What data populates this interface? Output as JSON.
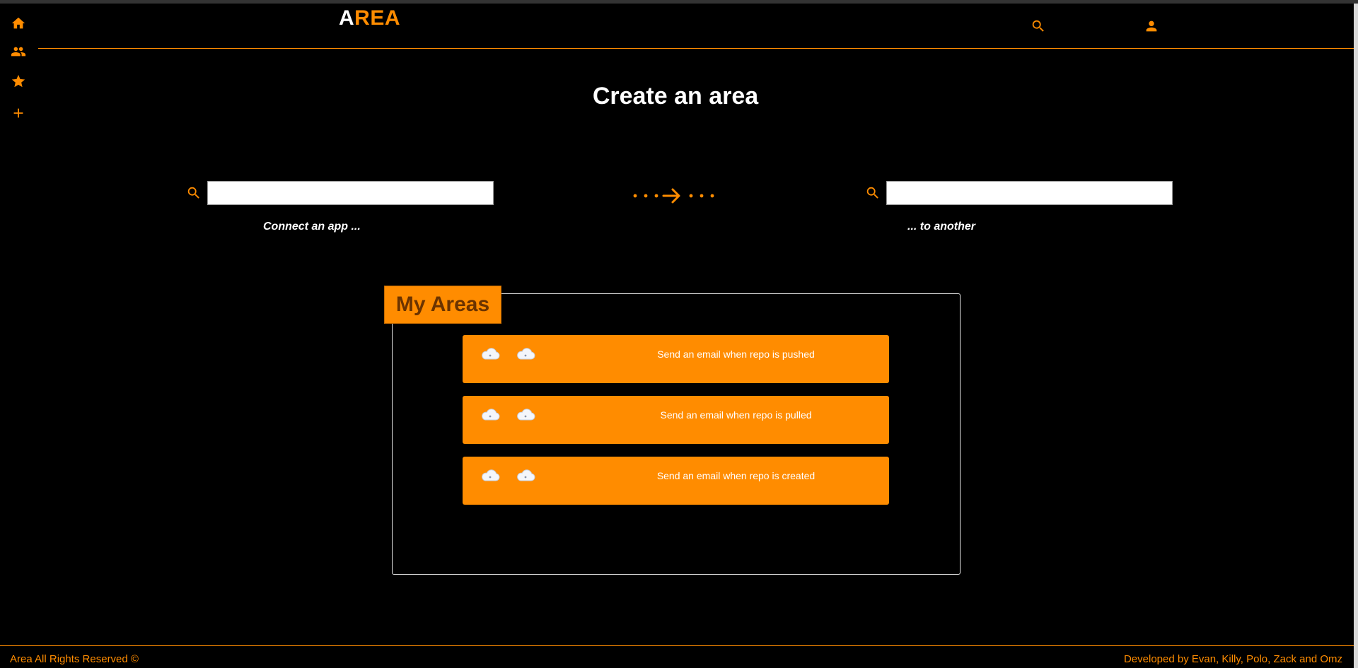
{
  "header": {
    "logo_first": "A",
    "logo_rest": "REA"
  },
  "sidebar": {
    "items": [
      {
        "icon": "home-icon"
      },
      {
        "icon": "users-icon"
      },
      {
        "icon": "star-icon"
      },
      {
        "icon": "plus-icon"
      }
    ]
  },
  "topbar_icons": [
    "search-icon",
    "user-icon"
  ],
  "main": {
    "title": "Create an area",
    "source_search": {
      "value": "",
      "caption": "Connect an app ..."
    },
    "target_search": {
      "value": "",
      "caption": "... to another"
    }
  },
  "areas": {
    "title": "My Areas",
    "items": [
      {
        "label": "Send an email when repo is pushed",
        "icons": [
          "cloud-icon",
          "cloud-icon"
        ]
      },
      {
        "label": "Send an email when repo is pulled",
        "icons": [
          "cloud-icon",
          "cloud-icon"
        ]
      },
      {
        "label": "Send an email when repo is created",
        "icons": [
          "cloud-icon",
          "cloud-icon"
        ]
      }
    ]
  },
  "footer": {
    "left": "Area All Rights Reserved ©",
    "right": "Developed by Evan, Killy, Polo, Zack and Omz"
  },
  "colors": {
    "accent": "#ff8c00",
    "background": "#000000",
    "text": "#ffffff"
  }
}
